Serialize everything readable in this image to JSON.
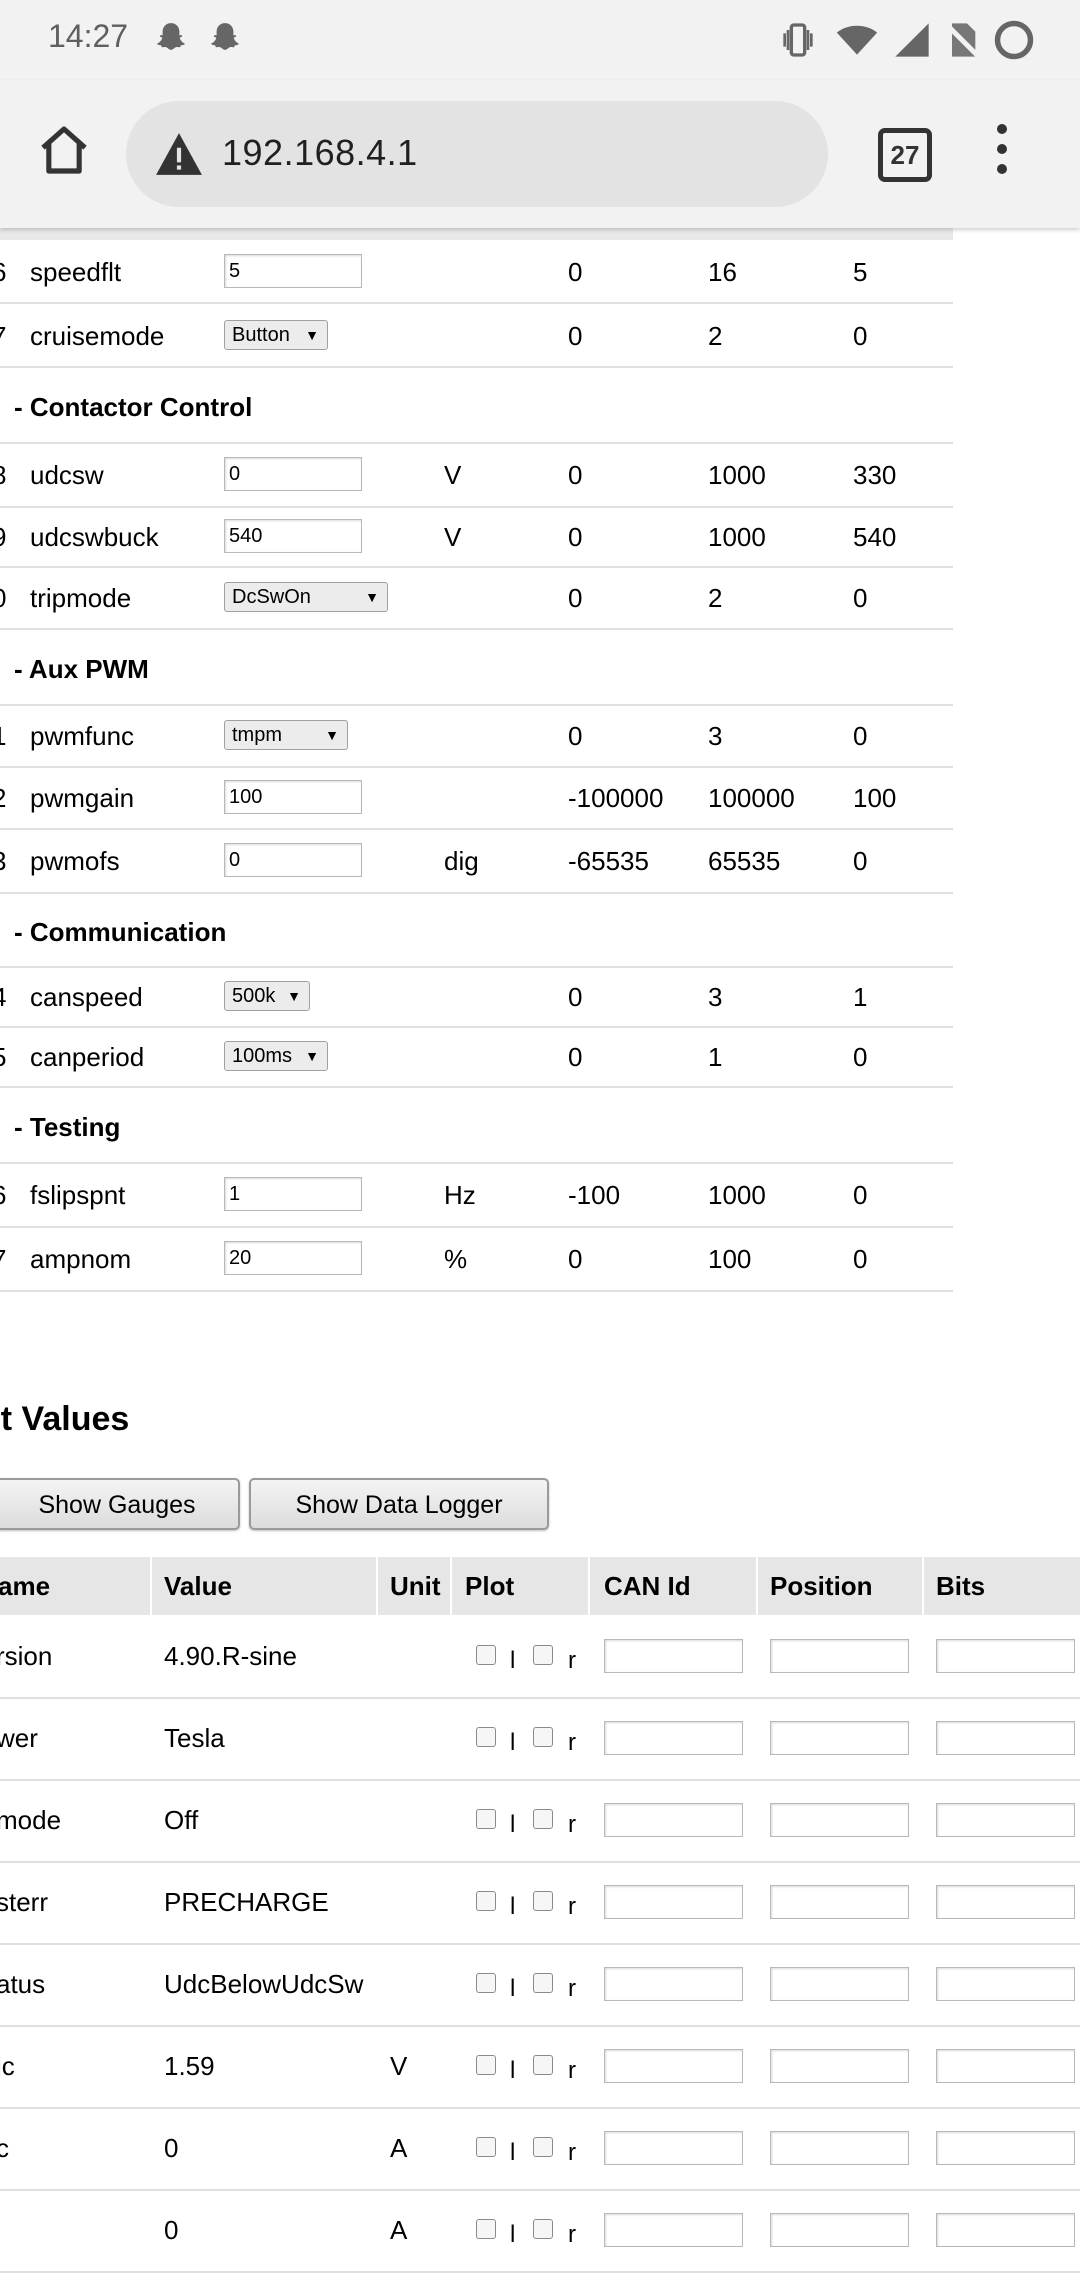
{
  "status_bar": {
    "time": "14:27",
    "icons": [
      "snapchat-icon",
      "snapchat-icon",
      "vibrate-icon",
      "wifi-icon",
      "signal-icon",
      "no-sim-icon",
      "battery-icon"
    ]
  },
  "browser": {
    "url": "192.168.4.1",
    "tab_count": "27",
    "icons": [
      "home-icon",
      "warning-icon",
      "tabs-icon",
      "more-menu-icon"
    ]
  },
  "params": {
    "rows": [
      {
        "type": "param",
        "idx": "6",
        "name": "speedflt",
        "control": "input",
        "value": "5",
        "unit": "",
        "min": "0",
        "max": "16",
        "def": "5"
      },
      {
        "type": "param",
        "idx": "7",
        "name": "cruisemode",
        "control": "select",
        "value": "Button",
        "unit": "",
        "min": "0",
        "max": "2",
        "def": "0"
      },
      {
        "type": "category",
        "title": "- Contactor Control"
      },
      {
        "type": "param",
        "idx": "8",
        "name": "udcsw",
        "control": "input",
        "value": "0",
        "unit": "V",
        "min": "0",
        "max": "1000",
        "def": "330"
      },
      {
        "type": "param",
        "idx": "9",
        "name": "udcswbuck",
        "control": "input",
        "value": "540",
        "unit": "V",
        "min": "0",
        "max": "1000",
        "def": "540"
      },
      {
        "type": "param",
        "idx": "0",
        "name": "tripmode",
        "control": "select",
        "value": "DcSwOn",
        "unit": "",
        "min": "0",
        "max": "2",
        "def": "0"
      },
      {
        "type": "category",
        "title": "- Aux PWM"
      },
      {
        "type": "param",
        "idx": "1",
        "name": "pwmfunc",
        "control": "select",
        "value": "tmpm",
        "unit": "",
        "min": "0",
        "max": "3",
        "def": "0"
      },
      {
        "type": "param",
        "idx": "2",
        "name": "pwmgain",
        "control": "input",
        "value": "100",
        "unit": "",
        "min": "-100000",
        "max": "100000",
        "def": "100"
      },
      {
        "type": "param",
        "idx": "3",
        "name": "pwmofs",
        "control": "input",
        "value": "0",
        "unit": "dig",
        "min": "-65535",
        "max": "65535",
        "def": "0"
      },
      {
        "type": "category",
        "title": "- Communication"
      },
      {
        "type": "param",
        "idx": "4",
        "name": "canspeed",
        "control": "select",
        "value": "500k",
        "unit": "",
        "min": "0",
        "max": "3",
        "def": "1"
      },
      {
        "type": "param",
        "idx": "5",
        "name": "canperiod",
        "control": "select",
        "value": "100ms",
        "unit": "",
        "min": "0",
        "max": "1",
        "def": "0"
      },
      {
        "type": "category",
        "title": "- Testing"
      },
      {
        "type": "param",
        "idx": "6",
        "name": "fslipspnt",
        "control": "input",
        "value": "1",
        "unit": "Hz",
        "min": "-100",
        "max": "1000",
        "def": "0"
      },
      {
        "type": "param",
        "idx": "7",
        "name": "ampnom",
        "control": "input",
        "value": "20",
        "unit": "%",
        "min": "0",
        "max": "100",
        "def": "0"
      }
    ]
  },
  "plot_values": {
    "title": "ot Values",
    "buttons": {
      "gauges": "Show Gauges",
      "logger": "Show Data Logger"
    },
    "headers": {
      "name": "ame",
      "value": "Value",
      "unit": "Unit",
      "plot": "Plot",
      "can_id": "CAN Id",
      "position": "Position",
      "bits": "Bits"
    },
    "rows": [
      {
        "name": "rsion",
        "value": "4.90.R-sine",
        "unit": ""
      },
      {
        "name": "wer",
        "value": "Tesla",
        "unit": ""
      },
      {
        "name": "mode",
        "value": "Off",
        "unit": ""
      },
      {
        "name": "sterr",
        "value": "PRECHARGE",
        "unit": ""
      },
      {
        "name": "atus",
        "value": "UdcBelowUdcSw",
        "unit": ""
      },
      {
        "name": "lc",
        "value": "1.59",
        "unit": "V"
      },
      {
        "name": "c",
        "value": "0",
        "unit": "A"
      },
      {
        "name": "",
        "value": "0",
        "unit": "A"
      }
    ],
    "plot_labels": {
      "left": "l",
      "right": "r"
    }
  }
}
